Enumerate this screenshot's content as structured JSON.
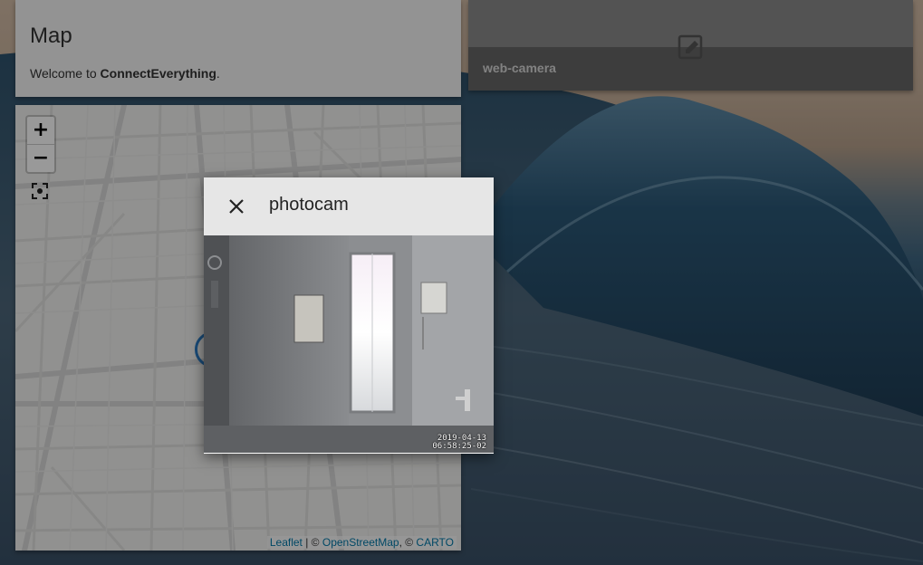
{
  "map_card": {
    "title": "Map",
    "welcome_prefix": "Welcome to ",
    "app_name": "ConnectEverything",
    "welcome_suffix": ".",
    "zoom_in_label": "+",
    "zoom_out_label": "−",
    "attribution": {
      "leaflet": "Leaflet",
      "sep1": " | © ",
      "osm": "OpenStreetMap",
      "sep2": ", © ",
      "carto": "CARTO"
    }
  },
  "camera_card": {
    "label": "web-camera",
    "icon": "edit-square-icon"
  },
  "dialog": {
    "title": "photocam",
    "close_icon": "close-icon",
    "timestamp_date": "2019-04-13",
    "timestamp_time": "06:58:25-02"
  },
  "colors": {
    "link": "#0078a8",
    "dialog_bar": "#e6e6e6"
  }
}
